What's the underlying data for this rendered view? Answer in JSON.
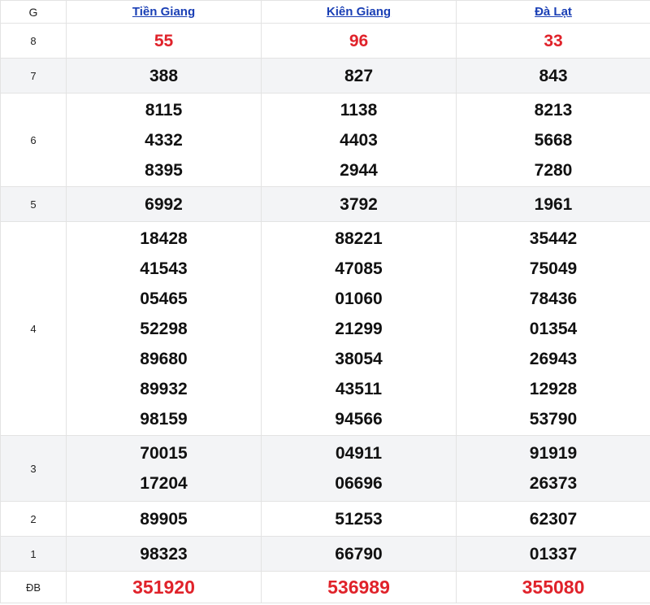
{
  "header": {
    "g_label": "G",
    "provinces": [
      "Tiền Giang",
      "Kiên Giang",
      "Đà Lạt"
    ]
  },
  "rows": {
    "g8": {
      "label": "8",
      "values": [
        [
          "55"
        ],
        [
          "96"
        ],
        [
          "33"
        ]
      ]
    },
    "g7": {
      "label": "7",
      "values": [
        [
          "388"
        ],
        [
          "827"
        ],
        [
          "843"
        ]
      ]
    },
    "g6": {
      "label": "6",
      "values": [
        [
          "8115",
          "4332",
          "8395"
        ],
        [
          "1138",
          "4403",
          "2944"
        ],
        [
          "8213",
          "5668",
          "7280"
        ]
      ]
    },
    "g5": {
      "label": "5",
      "values": [
        [
          "6992"
        ],
        [
          "3792"
        ],
        [
          "1961"
        ]
      ]
    },
    "g4": {
      "label": "4",
      "values": [
        [
          "18428",
          "41543",
          "05465",
          "52298",
          "89680",
          "89932",
          "98159"
        ],
        [
          "88221",
          "47085",
          "01060",
          "21299",
          "38054",
          "43511",
          "94566"
        ],
        [
          "35442",
          "75049",
          "78436",
          "01354",
          "26943",
          "12928",
          "53790"
        ]
      ]
    },
    "g3": {
      "label": "3",
      "values": [
        [
          "70015",
          "17204"
        ],
        [
          "04911",
          "06696"
        ],
        [
          "91919",
          "26373"
        ]
      ]
    },
    "g2": {
      "label": "2",
      "values": [
        [
          "89905"
        ],
        [
          "51253"
        ],
        [
          "62307"
        ]
      ]
    },
    "g1": {
      "label": "1",
      "values": [
        [
          "98323"
        ],
        [
          "66790"
        ],
        [
          "01337"
        ]
      ]
    },
    "db": {
      "label": "ĐB",
      "values": [
        [
          "351920"
        ],
        [
          "536989"
        ],
        [
          "355080"
        ]
      ]
    }
  },
  "colors": {
    "link": "#1a3fb5",
    "highlight": "#e0222a",
    "alt_row": "#f3f4f6"
  }
}
